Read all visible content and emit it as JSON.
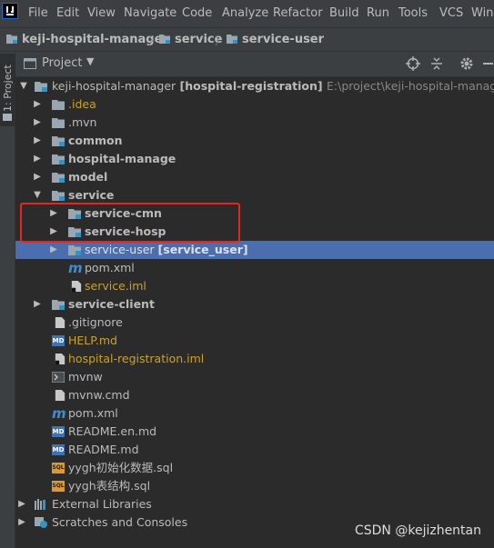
{
  "menubar": {
    "items": [
      "File",
      "Edit",
      "View",
      "Navigate",
      "Code",
      "Analyze",
      "Refactor",
      "Build",
      "Run",
      "Tools",
      "VCS",
      "Wind"
    ]
  },
  "breadcrumb": {
    "items": [
      "keji-hospital-manager",
      "service",
      "service-user"
    ]
  },
  "sidebar": {
    "tab_label": "1: Project"
  },
  "panel": {
    "title": "Project",
    "dropdown": "▼"
  },
  "tree": {
    "root": {
      "name": "keji-hospital-manager",
      "module": "[hospital-registration]",
      "path": "E:\\project\\keji-hospital-manager"
    },
    "items": [
      {
        "label": ".idea"
      },
      {
        "label": ".mvn"
      },
      {
        "label": "common"
      },
      {
        "label": "hospital-manage"
      },
      {
        "label": "model"
      },
      {
        "label": "service"
      },
      {
        "label": "service-cmn"
      },
      {
        "label": "service-hosp"
      },
      {
        "label": "service-user",
        "module": "[service_user]"
      },
      {
        "label": "pom.xml"
      },
      {
        "label": "service.iml"
      },
      {
        "label": "service-client"
      },
      {
        "label": ".gitignore"
      },
      {
        "label": "HELP.md"
      },
      {
        "label": "hospital-registration.iml"
      },
      {
        "label": "mvnw"
      },
      {
        "label": "mvnw.cmd"
      },
      {
        "label": "pom.xml"
      },
      {
        "label": "README.en.md"
      },
      {
        "label": "README.md"
      },
      {
        "label": "yygh初始化数据.sql"
      },
      {
        "label": "yygh表结构.sql"
      },
      {
        "label": "External Libraries"
      },
      {
        "label": "Scratches and Consoles"
      }
    ]
  },
  "watermark": "CSDN @kejizhentan",
  "colors": {
    "selection": "#4b6eaf",
    "highlight_box": "#e8241f"
  }
}
